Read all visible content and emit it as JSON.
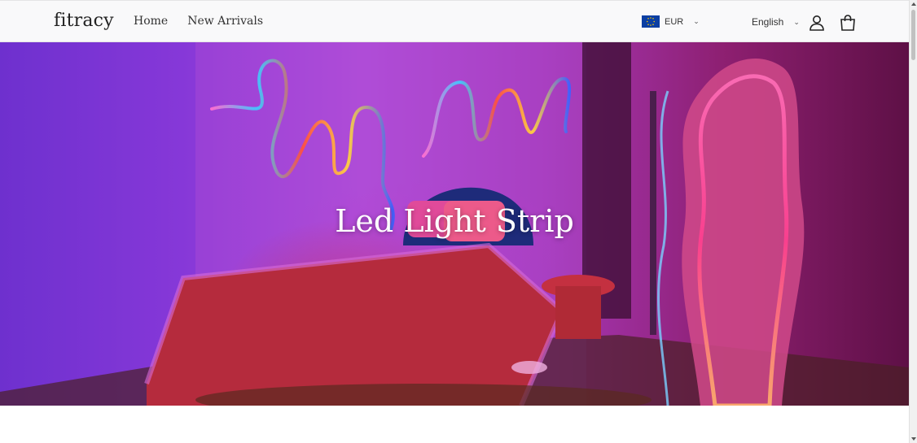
{
  "header": {
    "logo": "fitracy",
    "nav": [
      "Home",
      "New Arrivals"
    ],
    "currency": {
      "code": "EUR",
      "flag_icon": "eu-flag-icon"
    },
    "language": "English",
    "account_icon": "user-icon",
    "cart_icon": "shopping-bag-icon"
  },
  "hero": {
    "title": "Led Light Strip"
  },
  "colors": {
    "header_bg": "#f9f9fa",
    "hero_purple": "#8a37d6",
    "hero_pink": "#d0307a"
  }
}
